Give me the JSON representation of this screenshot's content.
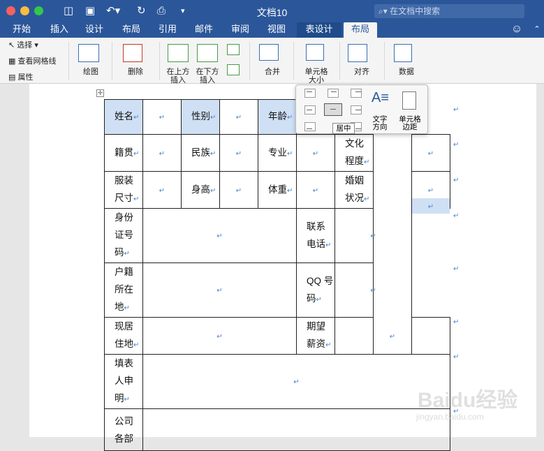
{
  "window": {
    "title": "文档10",
    "search_placeholder": "在文档中搜索"
  },
  "tabs": [
    "开始",
    "插入",
    "设计",
    "布局",
    "引用",
    "邮件",
    "审阅",
    "视图",
    "表设计",
    "布局"
  ],
  "ribbon": {
    "select": "选择",
    "gridlines": "查看网格线",
    "properties": "属性",
    "draw": "绘图",
    "delete": "删除",
    "insert_above": "在上方插入",
    "insert_below": "在下方插入",
    "merge": "合并",
    "cell_size": "单元格大小",
    "align": "对齐",
    "data": "数据"
  },
  "align_popup": {
    "tooltip": "居中",
    "text_direction": "文字方向",
    "cell_margins": "单元格边距"
  },
  "mark": "↵",
  "form": {
    "name": "姓名",
    "gender": "性别",
    "age": "年龄",
    "native": "籍贯",
    "ethnic": "民族",
    "major": "专业",
    "education": "文化程度",
    "size": "服装尺寸",
    "height": "身高",
    "weight": "体重",
    "marital": "婚姻状况",
    "id": "身份证号码",
    "phone": "联系电话",
    "hukou": "户籍所在地",
    "qq": "QQ 号码",
    "address": "现居住地",
    "salary": "期望薪资",
    "applicant": "填表人申明",
    "dept": "公司各部"
  },
  "watermark": {
    "brand": "Baidu经验",
    "url": "jingyan.baidu.com"
  }
}
